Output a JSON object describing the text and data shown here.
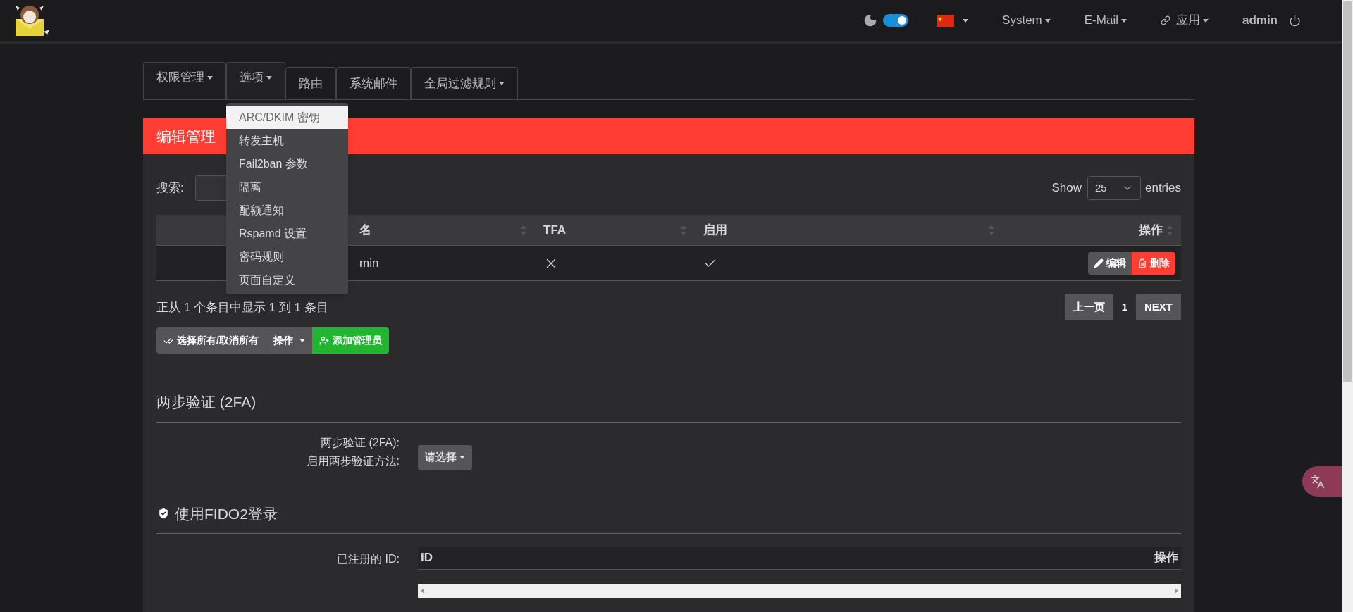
{
  "navbar": {
    "theme_toggle": {
      "on": true
    },
    "menus": [
      {
        "label": "System",
        "kind": "plain"
      },
      {
        "label": "E-Mail",
        "kind": "plain"
      },
      {
        "label": "应用",
        "kind": "link"
      }
    ],
    "user": "admin"
  },
  "tabs": [
    {
      "label": "权限管理",
      "dropdown": true,
      "selected": true,
      "expanded": false
    },
    {
      "label": "选项",
      "dropdown": true,
      "selected": false,
      "expanded": true
    },
    {
      "label": "路由",
      "dropdown": false,
      "selected": false,
      "expanded": false
    },
    {
      "label": "系统邮件",
      "dropdown": false,
      "selected": false,
      "expanded": false
    },
    {
      "label": "全局过滤规则",
      "dropdown": true,
      "selected": false,
      "expanded": false
    }
  ],
  "options_menu": [
    {
      "label": "ARC/DKIM 密钥",
      "highlighted": true
    },
    {
      "label": "转发主机",
      "highlighted": false
    },
    {
      "label": "Fail2ban 参数",
      "highlighted": false
    },
    {
      "label": "隔离",
      "highlighted": false
    },
    {
      "label": "配额通知",
      "highlighted": false
    },
    {
      "label": "Rspamd 设置",
      "highlighted": false
    },
    {
      "label": "密码规则",
      "highlighted": false
    },
    {
      "label": "页面自定义",
      "highlighted": false
    }
  ],
  "panel": {
    "title": "编辑管理",
    "search_label": "搜索:",
    "page_length": {
      "before": "Show",
      "value": "25",
      "after": "entries"
    },
    "table": {
      "columns": [
        {
          "kind": "blank"
        },
        {
          "label": "名",
          "kind": "text"
        },
        {
          "label": "TFA",
          "kind": "flag"
        },
        {
          "label": "启用",
          "kind": "flag"
        },
        {
          "label": "操作",
          "kind": "actions"
        }
      ],
      "rows": [
        {
          "username": "min",
          "tfa": false,
          "active": true,
          "actions": [
            {
              "label": "编辑",
              "kind": "edit"
            },
            {
              "label": "删除",
              "kind": "delete"
            }
          ]
        }
      ]
    },
    "info": "正从 1 个条目中显示 1 到 1 条目",
    "pagination": {
      "prev": "上一页",
      "pages": [
        {
          "label": "1",
          "selected": true
        }
      ],
      "next": "NEXT"
    },
    "bulk_buttons": [
      {
        "label": "选择所有/取消所有",
        "kind": "select-all"
      },
      {
        "label": "操作",
        "kind": "menu"
      },
      {
        "label": "添加管理员",
        "kind": "add"
      }
    ],
    "twofa": {
      "heading": "两步验证 (2FA)",
      "labels": [
        "两步验证 (2FA):",
        "启用两步验证方法:"
      ],
      "select": "请选择"
    },
    "fido": {
      "heading": "使用FIDO2登录",
      "label": "已注册的 ID:",
      "columns": [
        "ID",
        "操作"
      ]
    }
  }
}
